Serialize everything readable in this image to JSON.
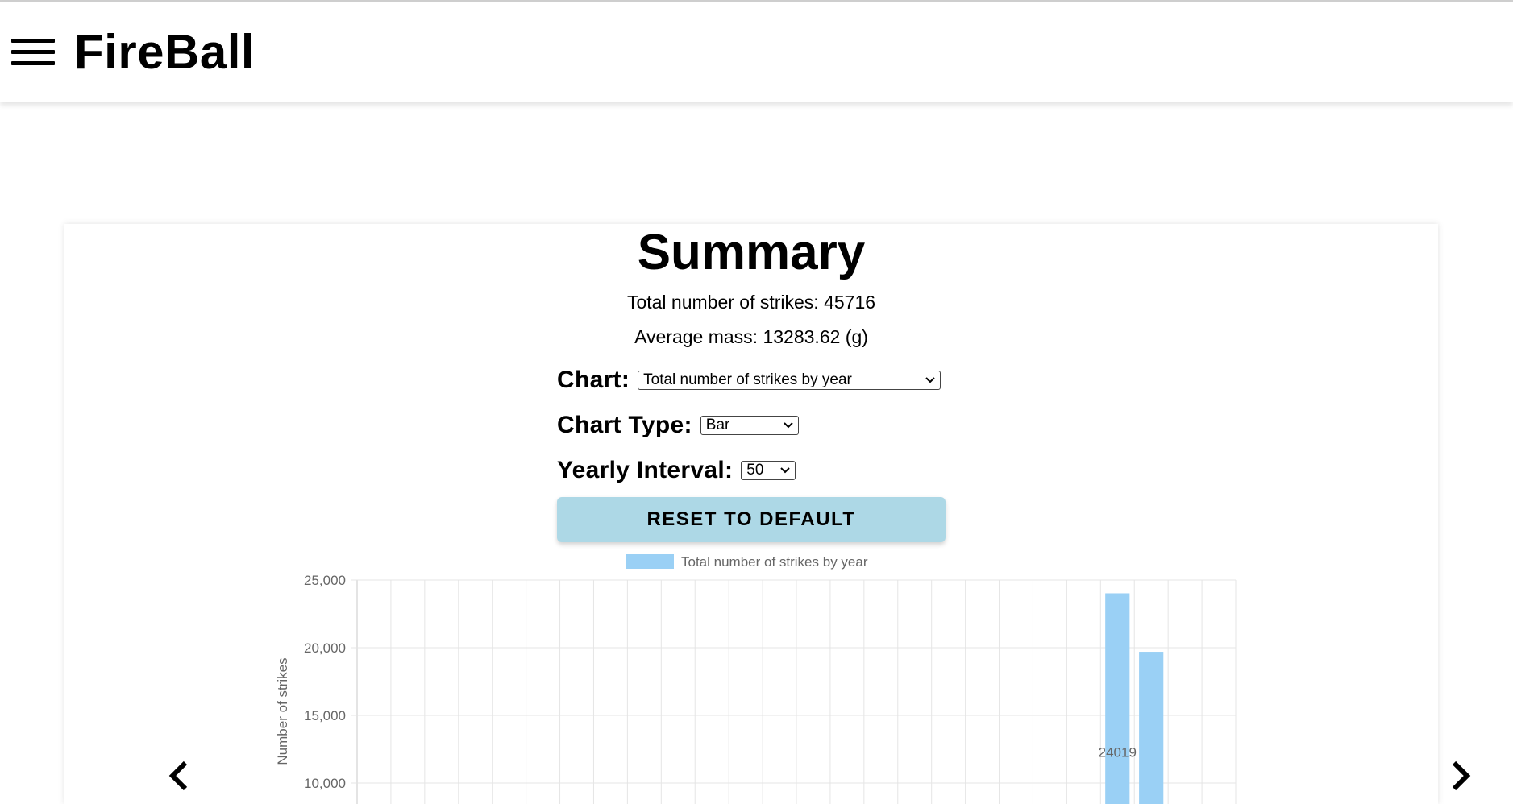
{
  "header": {
    "title": "FireBall",
    "menu_icon": "hamburger-menu-icon"
  },
  "summary": {
    "title": "Summary",
    "total_strikes": "Total number of strikes: 45716",
    "average_mass": "Average mass: 13283.62 (g)"
  },
  "controls": {
    "chart_label": "Chart:",
    "chart_value": "Total number of strikes by year",
    "chart_type_label": "Chart Type:",
    "chart_type_value": "Bar",
    "interval_label": "Yearly Interval:",
    "interval_value": "50",
    "reset_label": "RESET TO DEFAULT"
  },
  "nav": {
    "prev_icon": "chevron-left-icon",
    "next_icon": "chevron-right-icon"
  },
  "chart_data": {
    "type": "bar",
    "legend": [
      "Total number of strikes by year"
    ],
    "legend_position": "top",
    "ylabel": "Number of strikes",
    "ylim": [
      0,
      25000
    ],
    "yticks": [
      "25,000",
      "20,000",
      "15,000",
      "10,000"
    ],
    "grid": true,
    "color": "#9ad0f5",
    "series": [
      {
        "name": "Total number of strikes by year",
        "values": [
          24019,
          19700
        ]
      }
    ],
    "data_labels": [
      "24019"
    ]
  }
}
